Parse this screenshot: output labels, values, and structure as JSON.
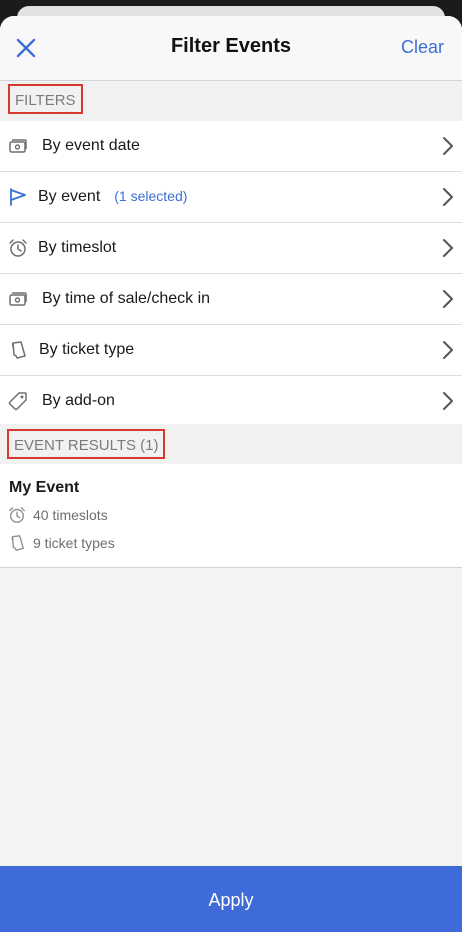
{
  "header": {
    "title": "Filter Events",
    "clear_label": "Clear",
    "close_icon": "close-icon"
  },
  "filters_section": {
    "label": "FILTERS",
    "items": [
      {
        "label": "By event date",
        "icon": "ticket-money-icon",
        "badge": ""
      },
      {
        "label": "By event",
        "icon": "flag-icon",
        "badge": "(1 selected)"
      },
      {
        "label": "By timeslot",
        "icon": "alarm-clock-icon",
        "badge": ""
      },
      {
        "label": "By time of sale/check in",
        "icon": "ticket-money-icon",
        "badge": ""
      },
      {
        "label": "By ticket type",
        "icon": "ticket-icon",
        "badge": ""
      },
      {
        "label": "By add-on",
        "icon": "tag-icon",
        "badge": ""
      }
    ]
  },
  "results_section": {
    "label": "EVENT RESULTS (1)",
    "event": {
      "name": "My Event",
      "timeslots": "40 timeslots",
      "ticket_types": "9 ticket types"
    }
  },
  "footer": {
    "apply_label": "Apply"
  },
  "colors": {
    "accent": "#3b6fd6",
    "apply_background": "#3f6bd8",
    "highlight_border": "#d63a2e"
  }
}
